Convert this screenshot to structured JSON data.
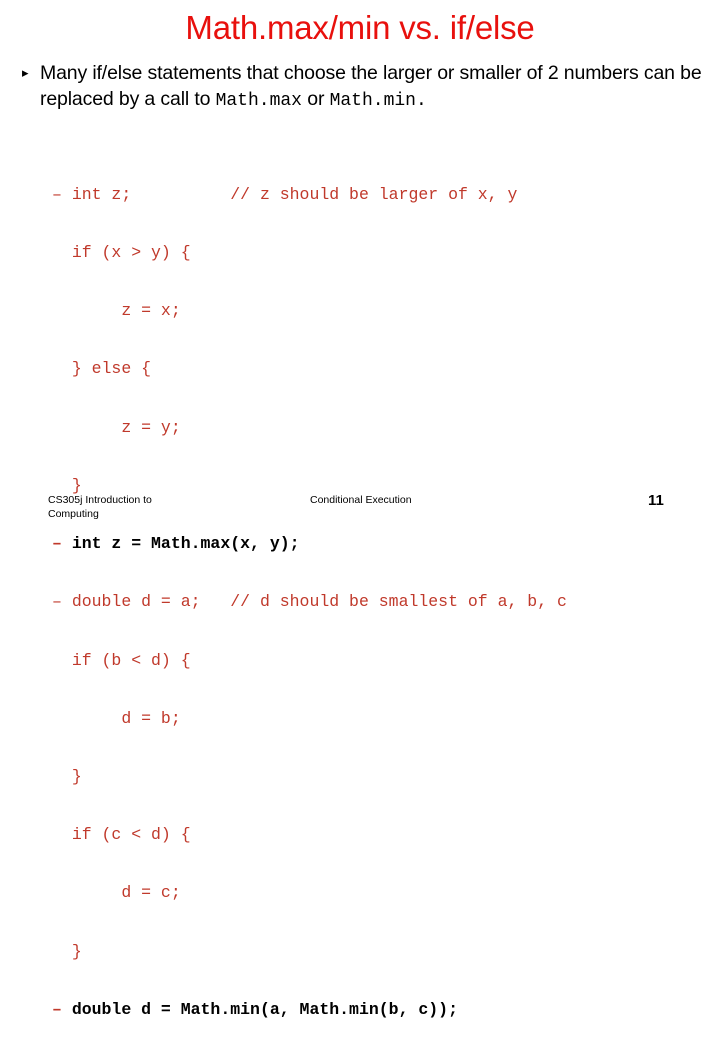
{
  "slide": {
    "title": "Math.max/min vs. if/else",
    "title_color": "#e8100d",
    "background_color": "#ffffff"
  },
  "bullets": [
    {
      "marker": "▸",
      "segments": [
        {
          "text": "Many if/else statements that choose the larger or smaller of 2 numbers can be replaced by a call to ",
          "style": "normal"
        },
        {
          "text": "Math.max",
          "style": "mono"
        },
        {
          "text": " or ",
          "style": "normal"
        },
        {
          "text": "Math.min.",
          "style": "mono"
        }
      ]
    }
  ],
  "code": {
    "color": "#c0392b",
    "emphasis_color": "#000000",
    "lines": [
      {
        "dash": "– ",
        "text": "int z;          // z should be larger of x, y",
        "emphasis": false
      },
      {
        "dash": "  ",
        "text": "if (x > y) {",
        "emphasis": false
      },
      {
        "dash": "  ",
        "text": "     z = x;",
        "emphasis": false
      },
      {
        "dash": "  ",
        "text": "} else {",
        "emphasis": false
      },
      {
        "dash": "  ",
        "text": "     z = y;",
        "emphasis": false
      },
      {
        "dash": "  ",
        "text": "}",
        "emphasis": false
      },
      {
        "dash": "– ",
        "text": "int z = Math.max(x, y);",
        "emphasis": true
      },
      {
        "dash": "– ",
        "text": "double d = a;   // d should be smallest of a, b, c",
        "emphasis": false
      },
      {
        "dash": "  ",
        "text": "if (b < d) {",
        "emphasis": false
      },
      {
        "dash": "  ",
        "text": "     d = b;",
        "emphasis": false
      },
      {
        "dash": "  ",
        "text": "}",
        "emphasis": false
      },
      {
        "dash": "  ",
        "text": "if (c < d) {",
        "emphasis": false
      },
      {
        "dash": "  ",
        "text": "     d = c;",
        "emphasis": false
      },
      {
        "dash": "  ",
        "text": "}",
        "emphasis": false
      },
      {
        "dash": "– ",
        "text": "double d = Math.min(a, Math.min(b, c));",
        "emphasis": true
      }
    ]
  },
  "footer": {
    "left_line1": "CS305j Introduction to",
    "left_line2": "Computing",
    "center": "Conditional Execution",
    "page_number": "11"
  }
}
